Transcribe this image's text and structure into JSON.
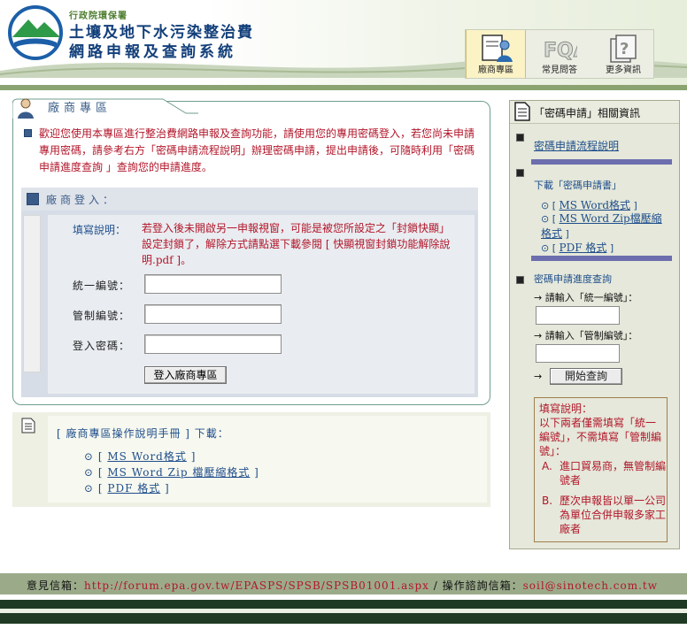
{
  "header": {
    "agency": "行政院環保署",
    "title_line1": "土壤及地下水污染整治費",
    "title_line2": "網路申報及查詢系統",
    "nav": [
      {
        "label": "廠商專區",
        "icon": "person-document-icon",
        "active": true
      },
      {
        "label": "常見問答",
        "icon": "faq-icon",
        "active": false
      },
      {
        "label": "更多資訊",
        "icon": "question-document-icon",
        "active": false
      }
    ]
  },
  "zone": {
    "title": "廠商專區",
    "intro": "歡迎您使用本專區進行整治費網路申報及查詢功能，請使用您的專用密碼登入，若您尚未申請專用密碼，請參考右方「密碼申請流程說明」辦理密碼申請，提出申請後，可隨時利用「密碼申請進度查詢 」查詢您的申請進度。"
  },
  "login": {
    "title": "廠商登入：",
    "note_label": "填寫說明：",
    "note_text": "若登入後未開啟另一申報視窗，可能是被您所設定之「封鎖快顯」設定封鎖了，解除方式請點選下載參閱 [ 快顯視窗封鎖功能解除說明.pdf ]。",
    "fields": [
      {
        "label": "統一編號：",
        "value": ""
      },
      {
        "label": "管制編號：",
        "value": ""
      },
      {
        "label": "登入密碼：",
        "value": ""
      }
    ],
    "button": "登入廠商專區"
  },
  "manual": {
    "title": "[ 廠商專區操作說明手冊 ] 下載：",
    "items": [
      "MS Word格式",
      "MS Word Zip 檔壓縮格式",
      "PDF 格式"
    ]
  },
  "sidebar": {
    "title": "「密碼申請」相關資訊",
    "flow_link": "密碼申請流程說明",
    "download_title": "下載「密碼申請書」",
    "downloads": [
      "MS Word格式",
      "MS Word Zip檔壓縮格式",
      "PDF 格式"
    ],
    "query_title": "密碼申請進度查詢",
    "query_prompt1": "→ 請輸入「統一編號」：",
    "query_prompt2": "→ 請輸入「管制編號」：",
    "query_button": "開始查詢",
    "note_title": "填寫說明：",
    "note_text": "以下兩者僅需填寫「統一編號」，不需填寫「管制編號」：",
    "note_items": [
      {
        "key": "A.",
        "text": "進口貿易商，無管制編號者"
      },
      {
        "key": "B.",
        "text": "歷次申報皆以單一公司為單位合併申報多家工廠者"
      }
    ]
  },
  "footer": {
    "feedback_label": "意見信箱：",
    "feedback_url": "http://forum.epa.gov.tw/EPASPS/SPSB/SPSB01001.aspx",
    "separator": " / ",
    "support_label": "操作諮詢信箱：",
    "support_email": "soil@sinotech.com.tw"
  },
  "colors": {
    "brand_blue": "#123f7a",
    "accent_red": "#b2162a",
    "link_blue": "#1f4e8c",
    "footer_green": "#9bab8a"
  }
}
